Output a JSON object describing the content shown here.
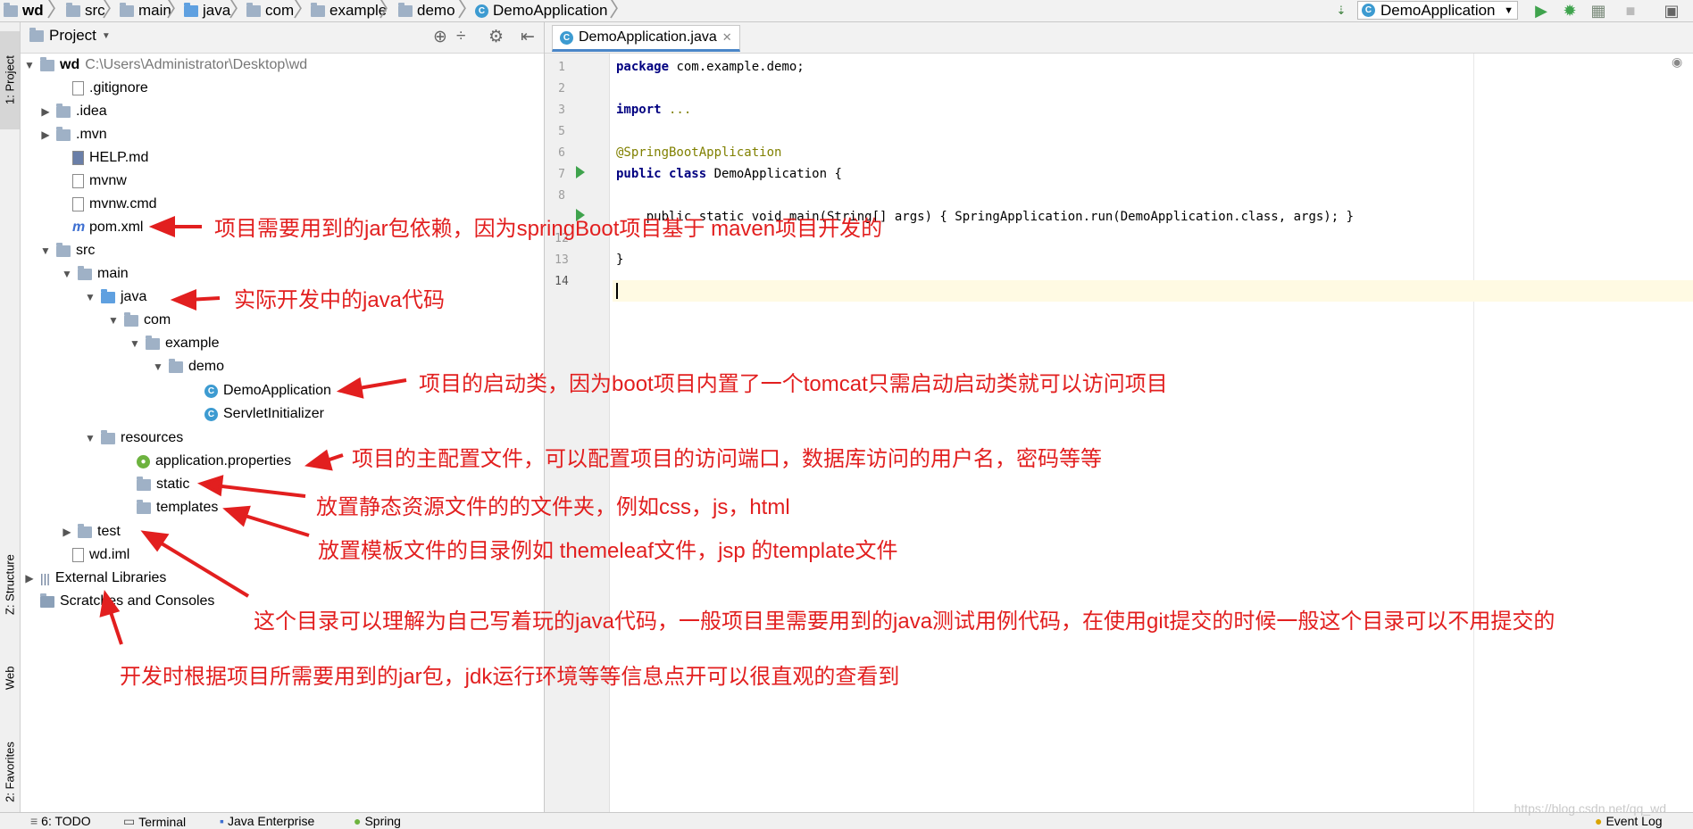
{
  "breadcrumbs": [
    "wd",
    "src",
    "main",
    "java",
    "com",
    "example",
    "demo",
    "DemoApplication"
  ],
  "run_config": "DemoApplication",
  "side_tabs": {
    "project": "1: Project",
    "structure": "Z: Structure",
    "web": "Web",
    "favorites": "2: Favorites"
  },
  "project": {
    "header": "Project",
    "root": {
      "name": "wd",
      "path": "C:\\Users\\Administrator\\Desktop\\wd"
    },
    "items": [
      ".gitignore",
      ".idea",
      ".mvn",
      "HELP.md",
      "mvnw",
      "mvnw.cmd",
      "pom.xml",
      "src",
      "main",
      "java",
      "com",
      "example",
      "demo",
      "DemoApplication",
      "ServletInitializer",
      "resources",
      "application.properties",
      "static",
      "templates",
      "test",
      "wd.iml",
      "External Libraries",
      "Scratches and Consoles"
    ]
  },
  "editor": {
    "tab": "DemoApplication.java",
    "lines": [
      "1",
      "2",
      "3",
      "5",
      "6",
      "7",
      "8",
      "12",
      "13",
      "14"
    ],
    "code": {
      "l1_kw": "package",
      "l1": " com.example.demo;",
      "l3_kw": "import",
      "l3": " ...",
      "l6": "@SpringBootApplication",
      "l7_kw": "public class",
      "l7": " DemoApplication {",
      "l9": "    public static void main(String[] args) { SpringApplication.run(DemoApplication.class, args); }",
      "l13": "}"
    }
  },
  "annotations": [
    "项目需要用到的jar包依赖，因为springBoot项目基于 maven项目开发的",
    "实际开发中的java代码",
    "项目的启动类，因为boot项目内置了一个tomcat只需启动启动类就可以访问项目",
    "项目的主配置文件，可以配置项目的访问端口，数据库访问的用户名，密码等等",
    "放置静态资源文件的的文件夹，例如css，js，html",
    "放置模板文件的目录例如 themeleaf文件，jsp 的template文件",
    "这个目录可以理解为自己写着玩的java代码，一般项目里需要用到的java测试用例代码，在使用git提交的时候一般这个目录可以不用提交的",
    "开发时根据项目所需要用到的jar包，jdk运行环境等等信息点开可以很直观的查看到"
  ],
  "bottom_tabs": [
    "6: TODO",
    "Terminal",
    "Java Enterprise",
    "Spring",
    "Event Log"
  ],
  "watermark": "https://blog.csdn.net/qq_wd",
  "colors": {
    "annotation": "#e21f1f",
    "keyword": "#000080",
    "current_line": "#fffae3"
  }
}
